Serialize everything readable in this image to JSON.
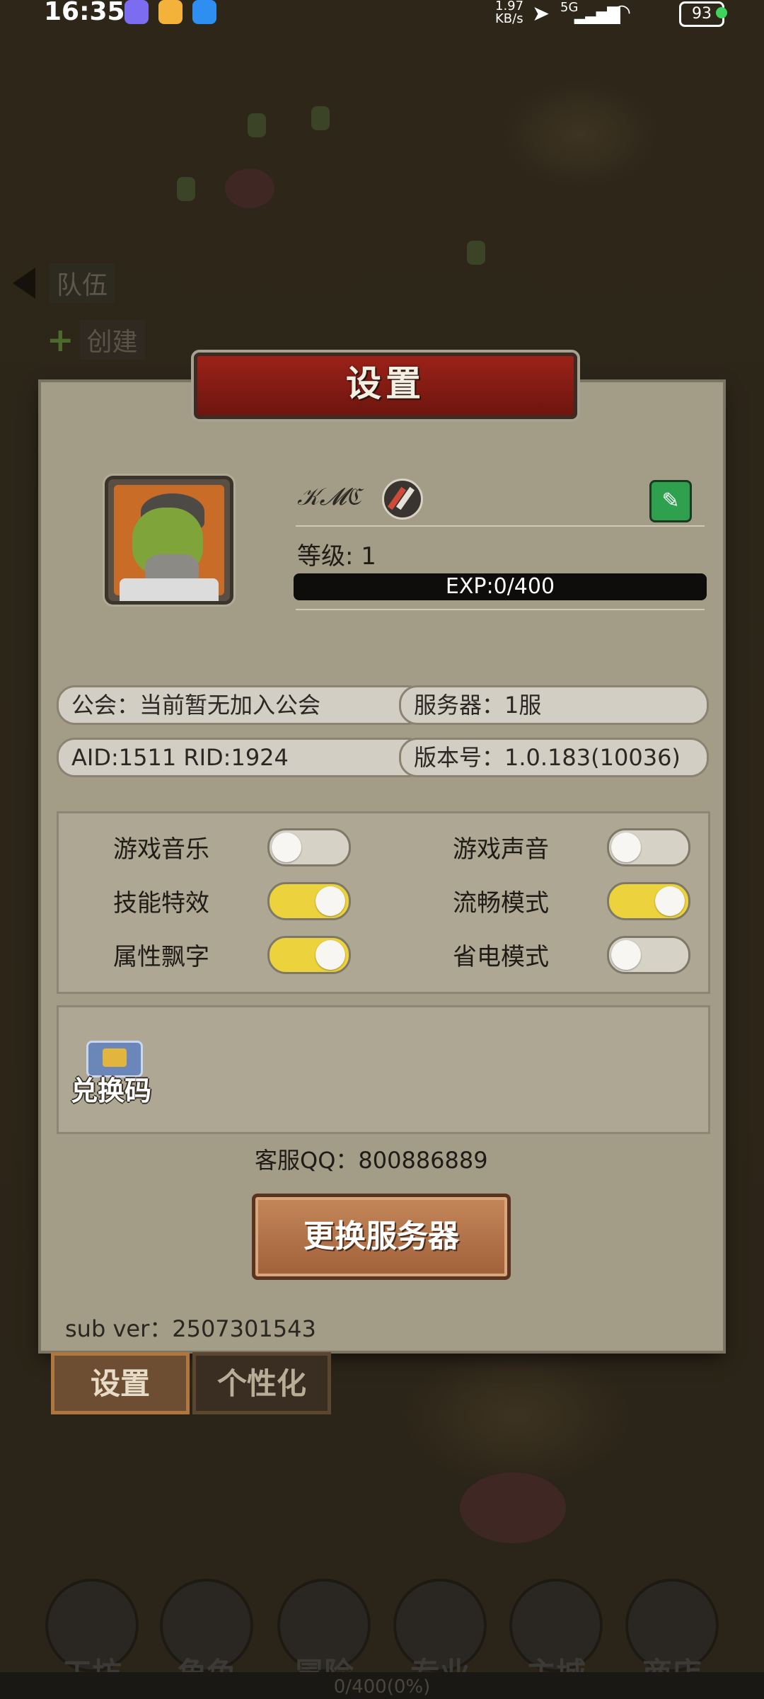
{
  "status_bar": {
    "time": "16:35",
    "net_speed_value": "1.97",
    "net_speed_unit": "KB/s",
    "network": "5G",
    "battery": "93",
    "app_icons": [
      "chat-app-icon",
      "folder-app-icon",
      "flight-app-icon"
    ]
  },
  "background": {
    "team_label": "队伍",
    "create_label": "创建",
    "bottom_nav": [
      "工坊",
      "角色",
      "冒险",
      "专业",
      "主城",
      "商店"
    ],
    "progress_text": "0/400(0%)"
  },
  "settings": {
    "title": "设置",
    "profile": {
      "username": "𝒦𝓜ℭ",
      "level_text": "等级: 1",
      "exp_text": "EXP:0/400",
      "exp_fraction": 0
    },
    "info": {
      "guild": "公会：当前暂无加入公会",
      "server": "服务器：1服",
      "ids": "AID:1511   RID:1924",
      "version": "版本号：1.0.183(10036)"
    },
    "toggles": [
      {
        "label": "游戏音乐",
        "on": false
      },
      {
        "label": "游戏声音",
        "on": false
      },
      {
        "label": "技能特效",
        "on": true
      },
      {
        "label": "流畅模式",
        "on": true
      },
      {
        "label": "属性飘字",
        "on": true
      },
      {
        "label": "省电模式",
        "on": false
      }
    ],
    "redeem_label": "兑换码",
    "support_qq": "客服QQ：800886889",
    "change_server_label": "更换服务器",
    "sub_ver": "sub ver：2507301543",
    "tabs": [
      "设置",
      "个性化"
    ]
  }
}
